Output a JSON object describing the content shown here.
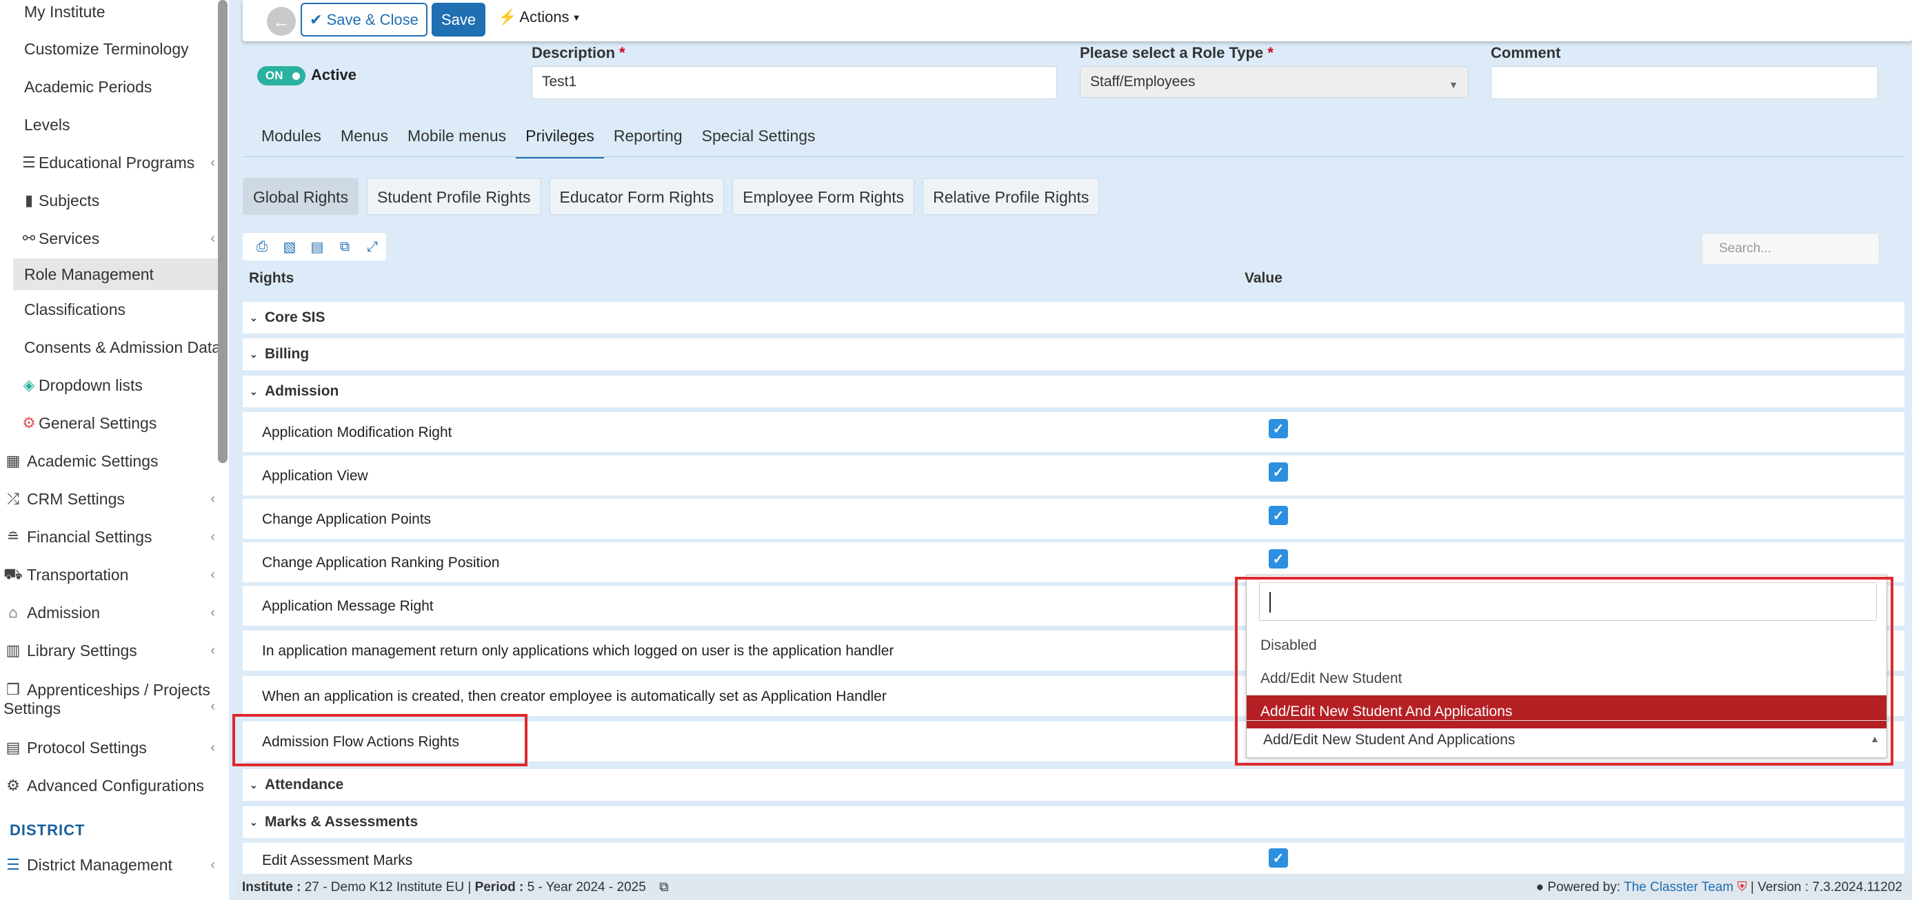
{
  "sidebar": {
    "sub_items": [
      {
        "label": "My Institute",
        "icon": ""
      },
      {
        "label": "Customize Terminology",
        "icon": ""
      },
      {
        "label": "Academic Periods",
        "icon": ""
      },
      {
        "label": "Levels",
        "icon": ""
      },
      {
        "label": "Educational Programs",
        "icon": "list-icon"
      },
      {
        "label": "Subjects",
        "icon": "book-icon"
      },
      {
        "label": "Services",
        "icon": "services-icon"
      },
      {
        "label": "Role Management",
        "icon": ""
      },
      {
        "label": "Classifications",
        "icon": ""
      },
      {
        "label": "Consents & Admission Data",
        "icon": ""
      },
      {
        "label": "Dropdown lists",
        "icon": "layers-icon"
      },
      {
        "label": "General Settings",
        "icon": "gear-icon"
      }
    ],
    "top_items": [
      {
        "label": "Academic Settings",
        "icon": "academic-icon"
      },
      {
        "label": "CRM Settings",
        "icon": "crm-icon"
      },
      {
        "label": "Financial Settings",
        "icon": "coins-icon"
      },
      {
        "label": "Transportation",
        "icon": "bus-icon"
      },
      {
        "label": "Admission",
        "icon": "building-icon"
      },
      {
        "label": "Library Settings",
        "icon": "library-icon"
      },
      {
        "label": "Apprenticeships / Projects",
        "label2": "Settings",
        "icon": "box-icon"
      },
      {
        "label": "Protocol Settings",
        "icon": "protocol-icon"
      },
      {
        "label": "Advanced Configurations",
        "icon": "gears-icon"
      }
    ],
    "district_heading": "DISTRICT",
    "district_item": "District Management"
  },
  "toolbar": {
    "save_close_label": "Save & Close",
    "save_label": "Save",
    "actions_label": "Actions"
  },
  "form": {
    "toggle_label": "ON",
    "active_label": "Active",
    "description_label": "Description",
    "description_value": "Test1",
    "role_type_label": "Please select a Role Type",
    "role_type_value": "Staff/Employees",
    "comment_label": "Comment",
    "required_mark": "*"
  },
  "tabs": [
    "Modules",
    "Menus",
    "Mobile menus",
    "Privileges",
    "Reporting",
    "Special Settings"
  ],
  "active_tab": "Privileges",
  "subtabs": [
    "Global Rights",
    "Student Profile Rights",
    "Educator Form Rights",
    "Employee Form Rights",
    "Relative Profile Rights"
  ],
  "search_placeholder": "Search...",
  "table": {
    "col_rights": "Rights",
    "col_value": "Value",
    "groups": {
      "core": "Core SIS",
      "billing": "Billing",
      "admission": "Admission",
      "attendance": "Attendance",
      "marks": "Marks & Assessments"
    },
    "admission_rows": [
      "Application Modification Right",
      "Application View",
      "Change Application Points",
      "Change Application Ranking Position",
      "Application Message Right",
      "In application management return only applications which logged on user is the application handler",
      "When an application is created, then creator employee is automatically set as Application Handler",
      "Admission Flow Actions Rights"
    ],
    "marks_rows": [
      "Edit Assessment Marks"
    ]
  },
  "dropdown": {
    "options": [
      "Disabled",
      "Add/Edit New Student",
      "Add/Edit New Student And Applications"
    ],
    "selected": "Add/Edit New Student And Applications",
    "current_value": "Add/Edit New Student And Applications"
  },
  "footer": {
    "institute_label": "Institute :",
    "institute_value": "27 - Demo K12 Institute EU",
    "period_label": "Period :",
    "period_value": "5 - Year 2024 - 2025",
    "powered_by": "Powered by:",
    "team": "The Classter Team",
    "version": "| Version : 7.3.2024.11202"
  },
  "colors": {
    "primary": "#1f6fb2",
    "selected_option": "#b52025",
    "highlight": "#e0282e",
    "toggle": "#2bb19f"
  }
}
